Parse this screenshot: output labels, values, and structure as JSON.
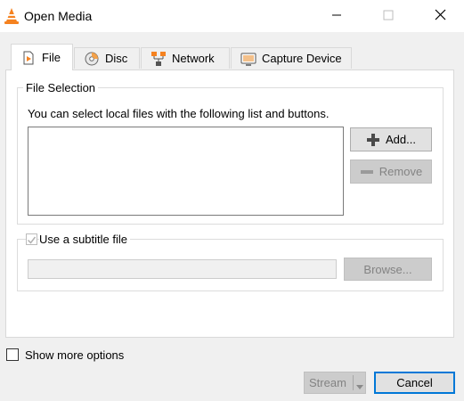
{
  "window": {
    "title": "Open Media",
    "app_icon": "vlc-cone-icon",
    "controls": [
      "minimize-icon",
      "maximize-icon",
      "close-icon"
    ]
  },
  "tabs": [
    {
      "label": "File",
      "icon": "file-icon",
      "active": true
    },
    {
      "label": "Disc",
      "icon": "disc-icon",
      "active": false
    },
    {
      "label": "Network",
      "icon": "network-icon",
      "active": false
    },
    {
      "label": "Capture Device",
      "icon": "capture-device-icon",
      "active": false
    }
  ],
  "file_selection": {
    "group_title": "File Selection",
    "hint": "You can select local files with the following list and buttons.",
    "add_label": "Add...",
    "remove_label": "Remove"
  },
  "subtitle": {
    "checkbox_label": "Use a subtitle file",
    "browse_label": "Browse..."
  },
  "footer": {
    "more_options_label": "Show more options",
    "stream_label": "Stream",
    "cancel_label": "Cancel"
  },
  "colors": {
    "accent_border": "#0078d7",
    "vlc_orange": "#f58220"
  }
}
